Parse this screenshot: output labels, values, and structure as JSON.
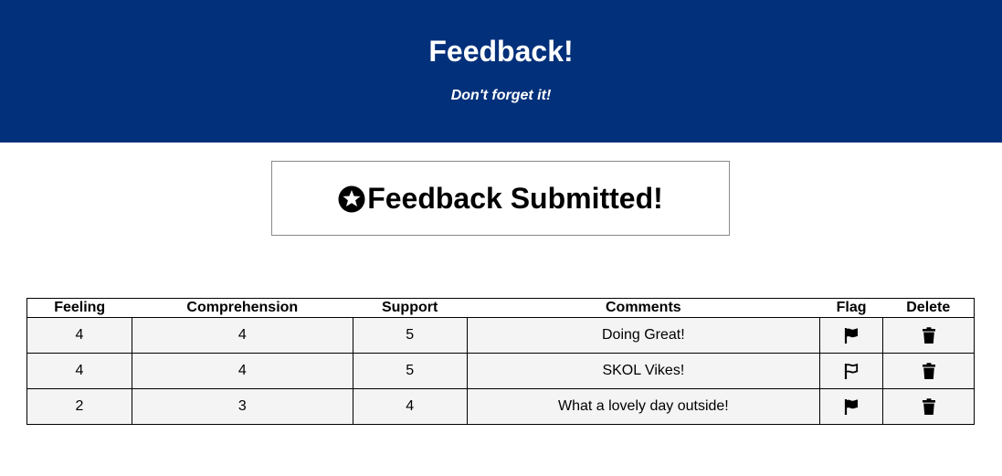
{
  "header": {
    "title": "Feedback!",
    "subtitle": "Don't forget it!",
    "background": "#03307a"
  },
  "banner": {
    "icon": "star-circle-icon",
    "text": "Feedback Submitted!"
  },
  "table": {
    "columns": [
      "Feeling",
      "Comprehension",
      "Support",
      "Comments",
      "Flag",
      "Delete"
    ],
    "rows": [
      {
        "feeling": "4",
        "comprehension": "4",
        "support": "5",
        "comments": "Doing Great!",
        "flagged": true
      },
      {
        "feeling": "4",
        "comprehension": "4",
        "support": "5",
        "comments": "SKOL Vikes!",
        "flagged": false
      },
      {
        "feeling": "2",
        "comprehension": "3",
        "support": "4",
        "comments": "What a lovely day outside!",
        "flagged": true
      }
    ],
    "flag_icon": "flag-icon",
    "delete_icon": "trash-icon"
  }
}
